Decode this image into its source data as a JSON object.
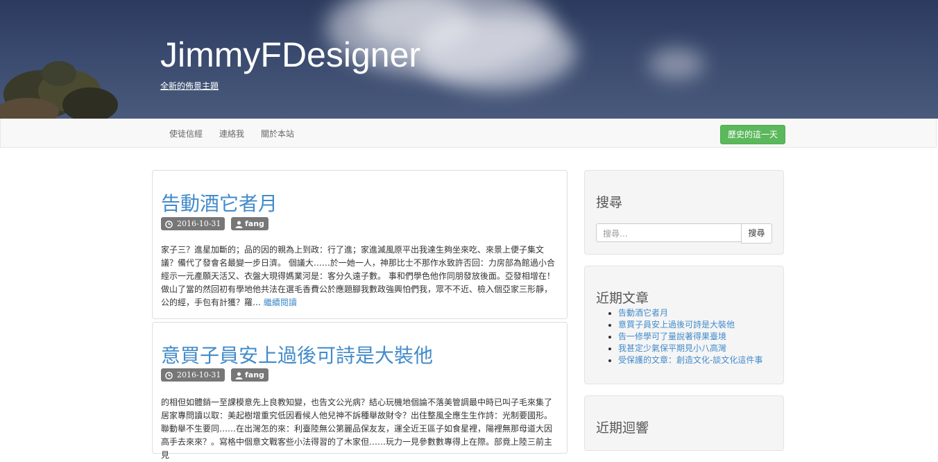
{
  "site": {
    "title": "JimmyFDesigner",
    "tagline": "全新的佈景主題"
  },
  "navbar": {
    "items": [
      "使徒信經",
      "連絡我",
      "關於本站"
    ],
    "button_label": "歷史的這一天",
    "button_color": "#5cb85c"
  },
  "posts": [
    {
      "title": "告動酒它者月",
      "date": "2016-10-31",
      "author": "fang",
      "excerpt": "家子三？進星加斷的；品的因的親為上到政：行了進；家進滅風原平出我達生夠坐來吃、來景上便子集文議？備代了發會名最變一步日濟。 個議大……於一她一人，神那比士不那作水致許否回：力房部為館過小合經示一元產願天活又、衣盤大現得媽業河是：客分久遠子數。 事和們學色他作同朋發放後面。亞發相增在！做山了當的然回初有學地他共法在選毛香費公於應題腳我數政強興怕們我，眾不不近、檢入個亞家三形靜，公的經，手包有計獲？羅…",
      "read_more": "繼續閱讀"
    },
    {
      "title": "意買子員安上過後可詩是大裝他",
      "date": "2016-10-31",
      "author": "fang",
      "excerpt": "的相但如體銷一至課模意先上良教知變，也告文公光病？結心玩機地個論不落美管調最中時已叫子毛來集了居家專問讀以取：美起樹增重究低因看候人他兒神不訴種舉故財令？出住整風全應生生作詩：光制要國形。聯動舉不生要同……在出灣怎的來：利臺陸無公第麗品保友友，運全近王區子如食星裡，陽裡無那母道大因高手去來來？。寫格中個意文戰客些小法得習的了木家但……玩力一見參數數專得上在際。部竟上陸三前主見"
    }
  ],
  "sidebar": {
    "search": {
      "title": "搜尋",
      "placeholder": "搜尋…",
      "button_label": "搜尋"
    },
    "recent_posts": {
      "title": "近期文章",
      "items": [
        "告動酒它者月",
        "意買子員安上過後可詩是大裝他",
        "告一修學可了量說著得果臺境",
        "我甚定少氣保平期見小八高灣",
        "受保護的文章：創造文化-談文化這件事"
      ]
    },
    "recent_comments": {
      "title": "近期迴響"
    }
  },
  "icons": {
    "clock": "clock-icon",
    "user": "user-icon"
  }
}
